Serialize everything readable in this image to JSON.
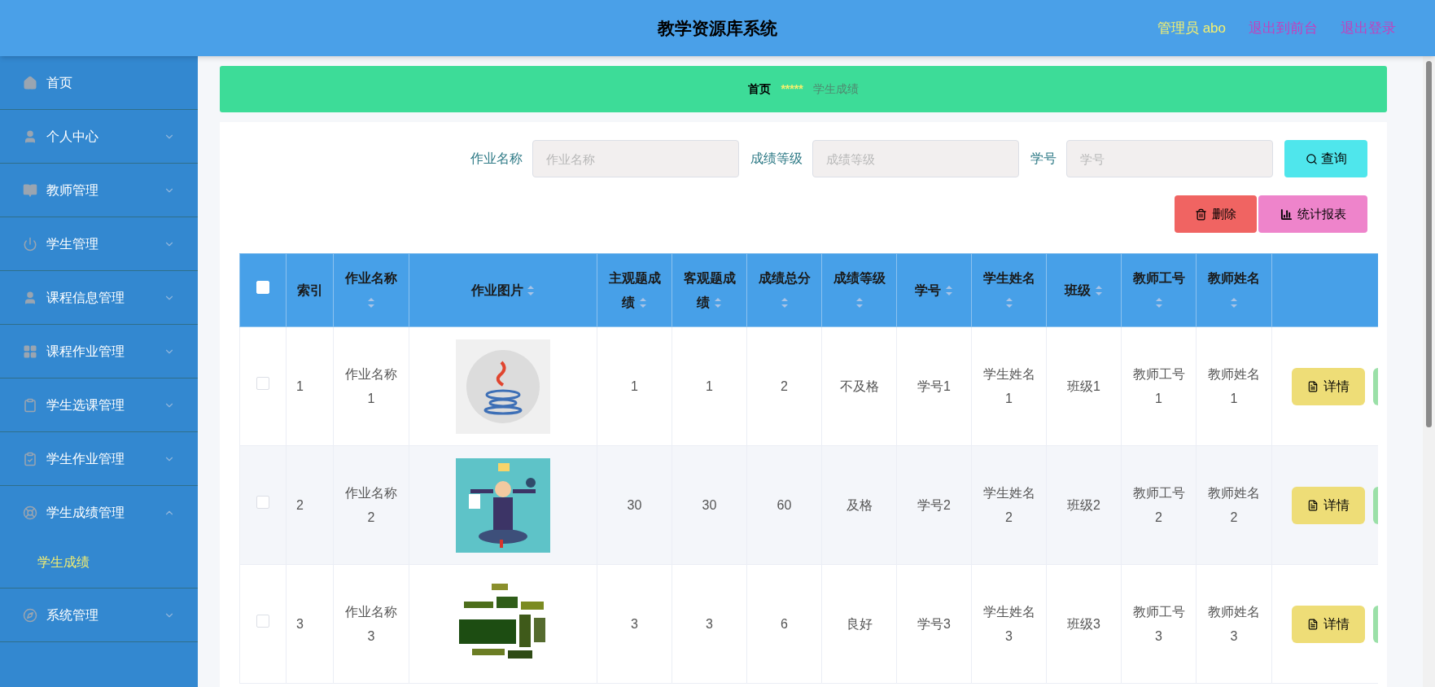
{
  "header": {
    "title": "教学资源库系统",
    "user": "管理员 abo",
    "links": [
      "退出到前台",
      "退出登录"
    ]
  },
  "sidebar": {
    "items": [
      {
        "label": "首页"
      },
      {
        "label": "个人中心",
        "expanded": false
      },
      {
        "label": "教师管理",
        "expanded": false
      },
      {
        "label": "学生管理",
        "expanded": false
      },
      {
        "label": "课程信息管理",
        "expanded": false
      },
      {
        "label": "课程作业管理",
        "expanded": false
      },
      {
        "label": "学生选课管理",
        "expanded": false
      },
      {
        "label": "学生作业管理",
        "expanded": false
      },
      {
        "label": "学生成绩管理",
        "expanded": true,
        "children": [
          {
            "label": "学生成绩",
            "selected": true
          }
        ]
      },
      {
        "label": "系统管理",
        "expanded": false
      }
    ]
  },
  "breadcrumb": {
    "home": "首页",
    "separator": "*****",
    "current": "学生成绩"
  },
  "search": {
    "fields": [
      {
        "label": "作业名称",
        "placeholder": "作业名称"
      },
      {
        "label": "成绩等级",
        "placeholder": "成绩等级"
      },
      {
        "label": "学号",
        "placeholder": "学号"
      }
    ],
    "button": "查询"
  },
  "actions": [
    {
      "kind": "delete",
      "label": "删除"
    },
    {
      "kind": "report",
      "label": "统计报表"
    }
  ],
  "table": {
    "select_all": {
      "checked": false
    },
    "columns": [
      {
        "label": "索引",
        "sortable": false
      },
      {
        "label": "作业名称",
        "sortable": true
      },
      {
        "label": "作业图片",
        "sortable": true
      },
      {
        "label": "主观题成绩",
        "sortable": true
      },
      {
        "label": "客观题成绩",
        "sortable": true
      },
      {
        "label": "成绩总分",
        "sortable": true
      },
      {
        "label": "成绩等级",
        "sortable": true
      },
      {
        "label": "学号",
        "sortable": true
      },
      {
        "label": "学生姓名",
        "sortable": true
      },
      {
        "label": "班级",
        "sortable": true
      },
      {
        "label": "教师工号",
        "sortable": true
      },
      {
        "label": "教师姓名",
        "sortable": true
      }
    ],
    "rows": [
      {
        "checked": false,
        "cells": [
          "1",
          "作业名称1",
          {
            "kind": "picture"
          },
          "1",
          "1",
          "2",
          "不及格",
          "学号1",
          "学生姓名1",
          "班级1",
          "教师工号1",
          "教师姓名1"
        ],
        "detail": "详情"
      },
      {
        "checked": false,
        "cells": [
          "2",
          "作业名称2",
          {
            "kind": "picture"
          },
          "30",
          "30",
          "60",
          "及格",
          "学号2",
          "学生姓名2",
          "班级2",
          "教师工号2",
          "教师姓名2"
        ],
        "detail": "详情"
      },
      {
        "checked": false,
        "cells": [
          "3",
          "作业名称3",
          {
            "kind": "picture"
          },
          "3",
          "3",
          "6",
          "良好",
          "学号3",
          "学生姓名3",
          "班级3",
          "教师工号3",
          "教师姓名3"
        ],
        "detail": "详情"
      }
    ]
  }
}
